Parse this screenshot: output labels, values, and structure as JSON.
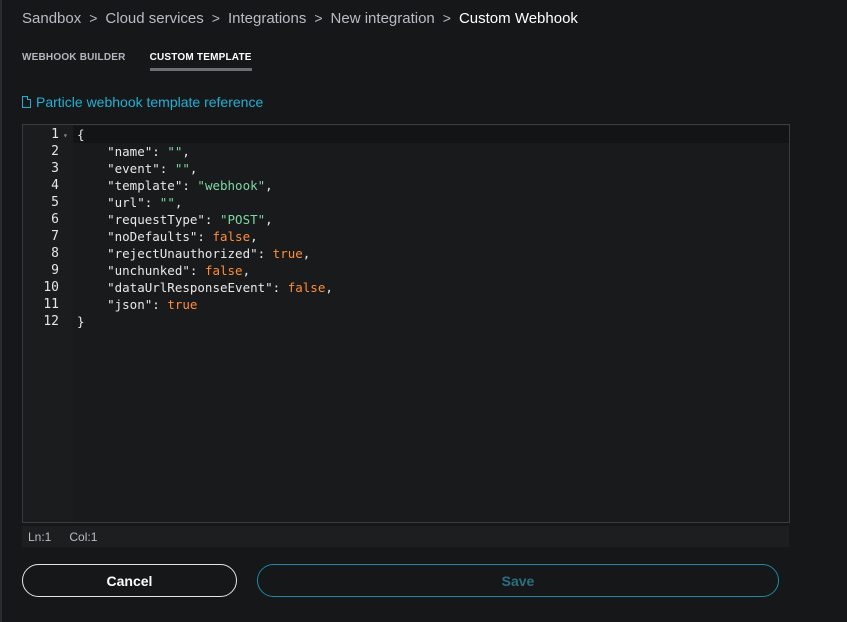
{
  "breadcrumb": {
    "items": [
      "Sandbox",
      "Cloud services",
      "Integrations",
      "New integration"
    ],
    "current": "Custom Webhook",
    "separator": ">"
  },
  "tabs": [
    {
      "label": "WEBHOOK BUILDER",
      "active": false
    },
    {
      "label": "CUSTOM TEMPLATE",
      "active": true
    }
  ],
  "reference_link": {
    "label": "Particle webhook template reference",
    "icon": "document-icon"
  },
  "editor": {
    "lines": [
      {
        "n": "1",
        "tokens": [
          [
            "punc",
            "{"
          ]
        ]
      },
      {
        "n": "2",
        "tokens": [
          [
            "key",
            "    \"name\": "
          ],
          [
            "str",
            "\"\""
          ],
          [
            "punc",
            ","
          ]
        ]
      },
      {
        "n": "3",
        "tokens": [
          [
            "key",
            "    \"event\": "
          ],
          [
            "str",
            "\"\""
          ],
          [
            "punc",
            ","
          ]
        ]
      },
      {
        "n": "4",
        "tokens": [
          [
            "key",
            "    \"template\": "
          ],
          [
            "str",
            "\"webhook\""
          ],
          [
            "punc",
            ","
          ]
        ]
      },
      {
        "n": "5",
        "tokens": [
          [
            "key",
            "    \"url\": "
          ],
          [
            "str",
            "\"\""
          ],
          [
            "punc",
            ","
          ]
        ]
      },
      {
        "n": "6",
        "tokens": [
          [
            "key",
            "    \"requestType\": "
          ],
          [
            "str",
            "\"POST\""
          ],
          [
            "punc",
            ","
          ]
        ]
      },
      {
        "n": "7",
        "tokens": [
          [
            "key",
            "    \"noDefaults\": "
          ],
          [
            "kw",
            "false"
          ],
          [
            "punc",
            ","
          ]
        ]
      },
      {
        "n": "8",
        "tokens": [
          [
            "key",
            "    \"rejectUnauthorized\": "
          ],
          [
            "kw",
            "true"
          ],
          [
            "punc",
            ","
          ]
        ]
      },
      {
        "n": "9",
        "tokens": [
          [
            "key",
            "    \"unchunked\": "
          ],
          [
            "kw",
            "false"
          ],
          [
            "punc",
            ","
          ]
        ]
      },
      {
        "n": "10",
        "tokens": [
          [
            "key",
            "    \"dataUrlResponseEvent\": "
          ],
          [
            "kw",
            "false"
          ],
          [
            "punc",
            ","
          ]
        ]
      },
      {
        "n": "11",
        "tokens": [
          [
            "key",
            "    \"json\": "
          ],
          [
            "kw",
            "true"
          ]
        ]
      },
      {
        "n": "12",
        "tokens": [
          [
            "punc",
            "}"
          ]
        ]
      }
    ],
    "fold_icon": "fold-triangle-icon"
  },
  "status": {
    "line": "Ln:1",
    "col": "Col:1"
  },
  "buttons": {
    "cancel": "Cancel",
    "save": "Save"
  },
  "colors": {
    "accent": "#1fb1d4",
    "string": "#7fd6a4",
    "keyword": "#ff8d3a",
    "background": "#161719"
  }
}
